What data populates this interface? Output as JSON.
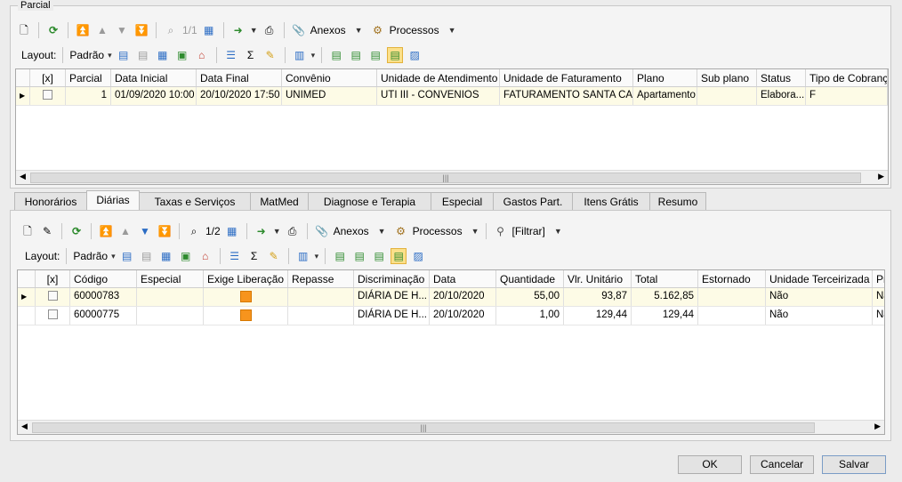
{
  "parcial": {
    "title": "Parcial",
    "toolbar": {
      "counter": "1/1",
      "anexos": "Anexos",
      "processos": "Processos"
    },
    "layout_label": "Layout:",
    "layout_value": "Padrão",
    "columns": [
      "[x]",
      "Parcial",
      "Data Inicial",
      "Data Final",
      "Convênio",
      "Unidade de Atendimento",
      "Unidade de Faturamento",
      "Plano",
      "Sub plano",
      "Status",
      "Tipo de Cobrança"
    ],
    "row": {
      "parcial": "1",
      "data_inicial": "01/09/2020 10:00",
      "data_final": "20/10/2020 17:50",
      "convenio": "UNIMED",
      "unidade_atendimento": "UTI III - CONVENIOS",
      "unidade_faturamento": "FATURAMENTO SANTA CASA",
      "plano": "Apartamento",
      "sub_plano": "",
      "status": "Elabora...",
      "tipo_cobranca": "F"
    }
  },
  "tabs": [
    "Honorários",
    "Diárias",
    "Taxas e Serviços",
    "MatMed",
    "Diagnose e Terapia",
    "Especial",
    "Gastos Part.",
    "Itens Grátis",
    "Resumo"
  ],
  "active_tab": "Diárias",
  "diarias": {
    "toolbar": {
      "counter": "1/2",
      "anexos": "Anexos",
      "processos": "Processos",
      "filtrar": "[Filtrar]"
    },
    "layout_label": "Layout:",
    "layout_value": "Padrão",
    "columns": [
      "[x]",
      "Código",
      "Especial",
      "Exige Liberação",
      "Repasse",
      "Discriminação",
      "Data",
      "Quantidade",
      "Vlr. Unitário",
      "Total",
      "Estornado",
      "Unidade Terceirizada",
      "Pr"
    ],
    "rows": [
      {
        "codigo": "60000783",
        "especial": "",
        "repasse": "",
        "discriminacao": "DIÁRIA DE H...",
        "data": "20/10/2020",
        "quantidade": "55,00",
        "vlr_unitario": "93,87",
        "total": "5.162,85",
        "estornado": "",
        "unidade_terceirizada": "Não",
        "pr": "Nã"
      },
      {
        "codigo": "60000775",
        "especial": "",
        "repasse": "",
        "discriminacao": "DIÁRIA DE H...",
        "data": "20/10/2020",
        "quantidade": "1,00",
        "vlr_unitario": "129,44",
        "total": "129,44",
        "estornado": "",
        "unidade_terceirizada": "Não",
        "pr": "Nã"
      }
    ]
  },
  "buttons": {
    "ok": "OK",
    "cancelar": "Cancelar",
    "salvar": "Salvar"
  },
  "colors": {
    "selected_row": "#fdfbe6",
    "orange_marker": "#f7941d",
    "refresh_green": "#2e8b2e",
    "nav_blue": "#2b6cc4"
  },
  "icons": [
    "new-icon",
    "edit-icon",
    "refresh-icon",
    "first-icon",
    "prev-icon",
    "next-icon",
    "last-icon",
    "binoculars-icon",
    "calendar-icon",
    "export-icon",
    "print-icon",
    "paperclip-icon",
    "gears-icon",
    "filter-icon",
    "chart-icon"
  ]
}
